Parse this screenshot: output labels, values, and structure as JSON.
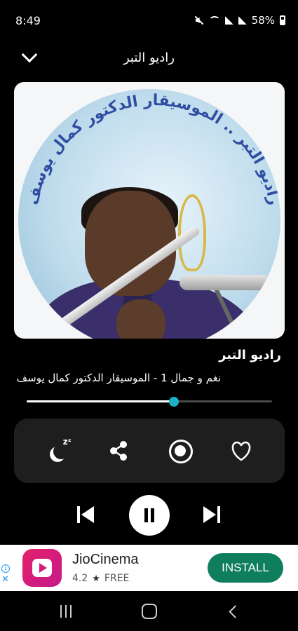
{
  "status_bar": {
    "time": "8:49",
    "battery": "58%"
  },
  "header": {
    "title": "راديو التبر"
  },
  "artwork": {
    "arc_text": "راديو التبر .. الموسيقار الدكتور كمال يوسف"
  },
  "now_playing": {
    "station_name": "راديو التبر",
    "track_title": "نغم و جمال 1 - الموسيقار الدكتور كمال يوسف"
  },
  "progress": {
    "fraction": 0.6
  },
  "controls": {
    "icons": [
      "sleep-timer-icon",
      "share-icon",
      "record-icon",
      "favorite-icon"
    ]
  },
  "transport": {
    "icons": [
      "previous-icon",
      "pause-icon",
      "next-icon"
    ]
  },
  "ad": {
    "app_name": "JioCinema",
    "rating": "4.2",
    "price": "FREE",
    "install_label": "INSTALL",
    "accent": "#0f7e5c"
  },
  "colors": {
    "background": "#000000",
    "panel": "#1e1e1e",
    "progress_thumb": "#1ab3c6"
  }
}
